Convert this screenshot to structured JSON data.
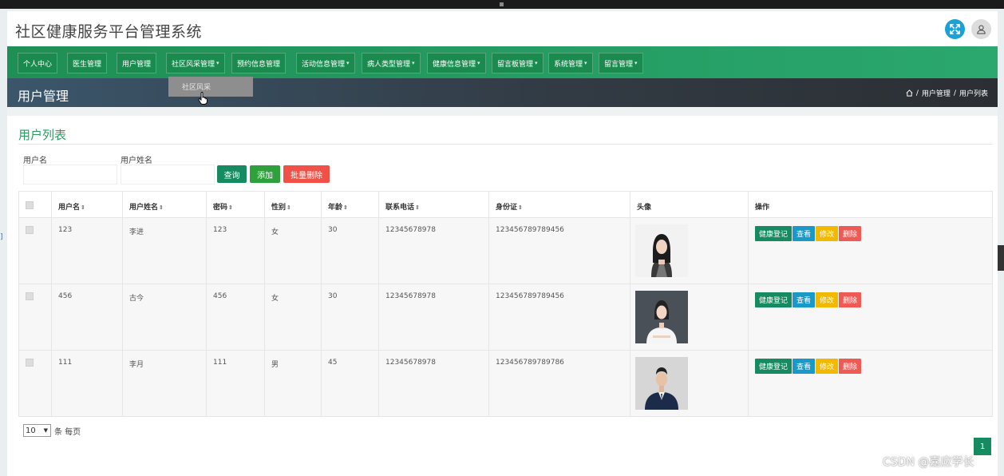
{
  "app": {
    "title": "社区健康服务平台管理系统"
  },
  "header": {
    "fullscreen_icon": "expand-icon",
    "user_icon": "user-icon"
  },
  "nav": [
    {
      "label": "个人中心",
      "has_caret": false
    },
    {
      "label": "医生管理",
      "has_caret": false
    },
    {
      "label": "用户管理",
      "has_caret": false
    },
    {
      "label": "社区风采管理",
      "has_caret": true
    },
    {
      "label": "预约信息管理",
      "has_caret": false
    },
    {
      "label": "活动信息管理",
      "has_caret": true
    },
    {
      "label": "病人类型管理",
      "has_caret": true
    },
    {
      "label": "健康信息管理",
      "has_caret": true
    },
    {
      "label": "留言板管理",
      "has_caret": true
    },
    {
      "label": "系统管理",
      "has_caret": true
    },
    {
      "label": "留言管理",
      "has_caret": true
    }
  ],
  "dropdown": {
    "item": "社区风采"
  },
  "banner": {
    "title": "用户管理",
    "breadcrumb": [
      "用户管理",
      "用户列表"
    ],
    "separator": "/"
  },
  "card": {
    "title": "用户列表"
  },
  "filters": {
    "username_label": "用户名",
    "realname_label": "用户姓名",
    "search_button": "查询",
    "add_button": "添加",
    "bulk_delete_button": "批量删除"
  },
  "table": {
    "headers": [
      "用户名",
      "用户姓名",
      "密码",
      "性别",
      "年龄",
      "联系电话",
      "身份证",
      "头像",
      "操作"
    ],
    "sortable": [
      true,
      true,
      true,
      true,
      true,
      true,
      true,
      false,
      false
    ],
    "rows": [
      {
        "username": "123",
        "name": "李进",
        "password": "123",
        "gender": "女",
        "age": "30",
        "phone": "12345678978",
        "idcard": "123456789789456",
        "avatar": "woman-portrait"
      },
      {
        "username": "456",
        "name": "古今",
        "password": "456",
        "gender": "女",
        "age": "30",
        "phone": "12345678978",
        "idcard": "123456789789456",
        "avatar": "woman-portrait"
      },
      {
        "username": "111",
        "name": "李月",
        "password": "111",
        "gender": "男",
        "age": "45",
        "phone": "12345678978",
        "idcard": "123456789789786",
        "avatar": "man-portrait"
      }
    ],
    "actions": [
      "健康登记",
      "查看",
      "修改",
      "删除"
    ]
  },
  "pager": {
    "page_size": "10",
    "page_size_suffix": "条 每页",
    "current_page": "1"
  },
  "watermark": "CSDN @嘉应学长",
  "colors": {
    "nav_green": "#1f8f55",
    "title_green": "#2a9b5e",
    "view_blue": "#1899c8",
    "edit_yellow": "#f3b800",
    "delete_red": "#f05a55"
  }
}
